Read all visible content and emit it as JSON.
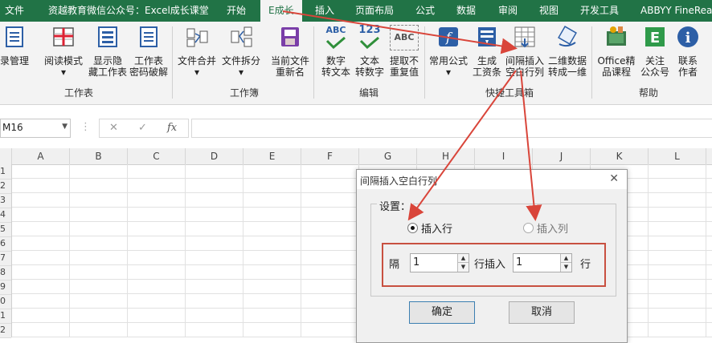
{
  "tabs": [
    {
      "label": "文件"
    },
    {
      "label": "资越教育微信公众号：Excel成长课堂"
    },
    {
      "label": "开始"
    },
    {
      "label": "E成长"
    },
    {
      "label": "插入"
    },
    {
      "label": "页面布局"
    },
    {
      "label": "公式"
    },
    {
      "label": "数据"
    },
    {
      "label": "审阅"
    },
    {
      "label": "视图"
    },
    {
      "label": "开发工具"
    },
    {
      "label": "ABBYY FineRea"
    }
  ],
  "ribbon": {
    "groups": [
      {
        "label": "工作表"
      },
      {
        "label": "工作簿"
      },
      {
        "label": "编辑"
      },
      {
        "label": "快捷工具箱"
      },
      {
        "label": "帮助"
      }
    ],
    "buttons": [
      {
        "line1": "录管理",
        "line2": "",
        "icon": "directory-icon"
      },
      {
        "line1": "阅读模式",
        "line2": "▾",
        "icon": "reading-mode-icon"
      },
      {
        "line1": "显示隐",
        "line2": "藏工作表",
        "icon": "show-hide-sheet-icon"
      },
      {
        "line1": "工作表",
        "line2": "密码破解",
        "icon": "sheet-password-icon"
      },
      {
        "line1": "文件合并",
        "line2": "▾",
        "icon": "file-merge-icon"
      },
      {
        "line1": "文件拆分",
        "line2": "▾",
        "icon": "file-split-icon"
      },
      {
        "line1": "当前文件",
        "line2": "重新名",
        "icon": "rename-file-icon"
      },
      {
        "line1": "数字",
        "line2": "转文本",
        "icon": "abc-number-to-text-icon",
        "glyph": "ABC"
      },
      {
        "line1": "文本",
        "line2": "转数字",
        "icon": "123-text-to-number-icon",
        "glyph": "123"
      },
      {
        "line1": "提取不",
        "line2": "重复值",
        "icon": "extract-unique-icon",
        "glyph": "ABC"
      },
      {
        "line1": "常用公式",
        "line2": "▾",
        "icon": "formula-icon"
      },
      {
        "line1": "生成",
        "line2": "工资条",
        "icon": "payslip-icon"
      },
      {
        "line1": "间隔插入",
        "line2": "空白行列",
        "icon": "insert-blank-rows-icon"
      },
      {
        "line1": "二维数据",
        "line2": "转成一维",
        "icon": "2d-to-1d-icon"
      },
      {
        "line1": "Office精",
        "line2": "品课程",
        "icon": "office-course-icon"
      },
      {
        "line1": "关注",
        "line2": "公众号",
        "icon": "follow-account-icon"
      },
      {
        "line1": "联系",
        "line2": "作者",
        "icon": "info-icon",
        "glyph": "i"
      }
    ]
  },
  "formula_bar": {
    "name_box": "M16",
    "cancel_glyph": "✕",
    "enter_glyph": "✓",
    "fx_glyph": "fx",
    "formula": ""
  },
  "columns": [
    "A",
    "B",
    "C",
    "D",
    "E",
    "F",
    "G",
    "H",
    "I",
    "J",
    "K",
    "L"
  ],
  "rows": [
    "1",
    "2",
    "3",
    "4",
    "5",
    "6",
    "7",
    "8",
    "9",
    "0",
    "1",
    "2"
  ],
  "dialog": {
    "title": "间隔插入空白行列",
    "close": "✕",
    "legend": "设置：",
    "radio_rows": "插入行",
    "radio_cols": "插入列",
    "selected": "rows",
    "every_label": "隔",
    "every_value": "1",
    "rows_insert_label": "行插入",
    "insert_value": "1",
    "unit_label": "行",
    "ok": "确定",
    "cancel": "取消"
  },
  "colors": {
    "excel_green": "#217346",
    "annotation_red": "#d9453a"
  }
}
